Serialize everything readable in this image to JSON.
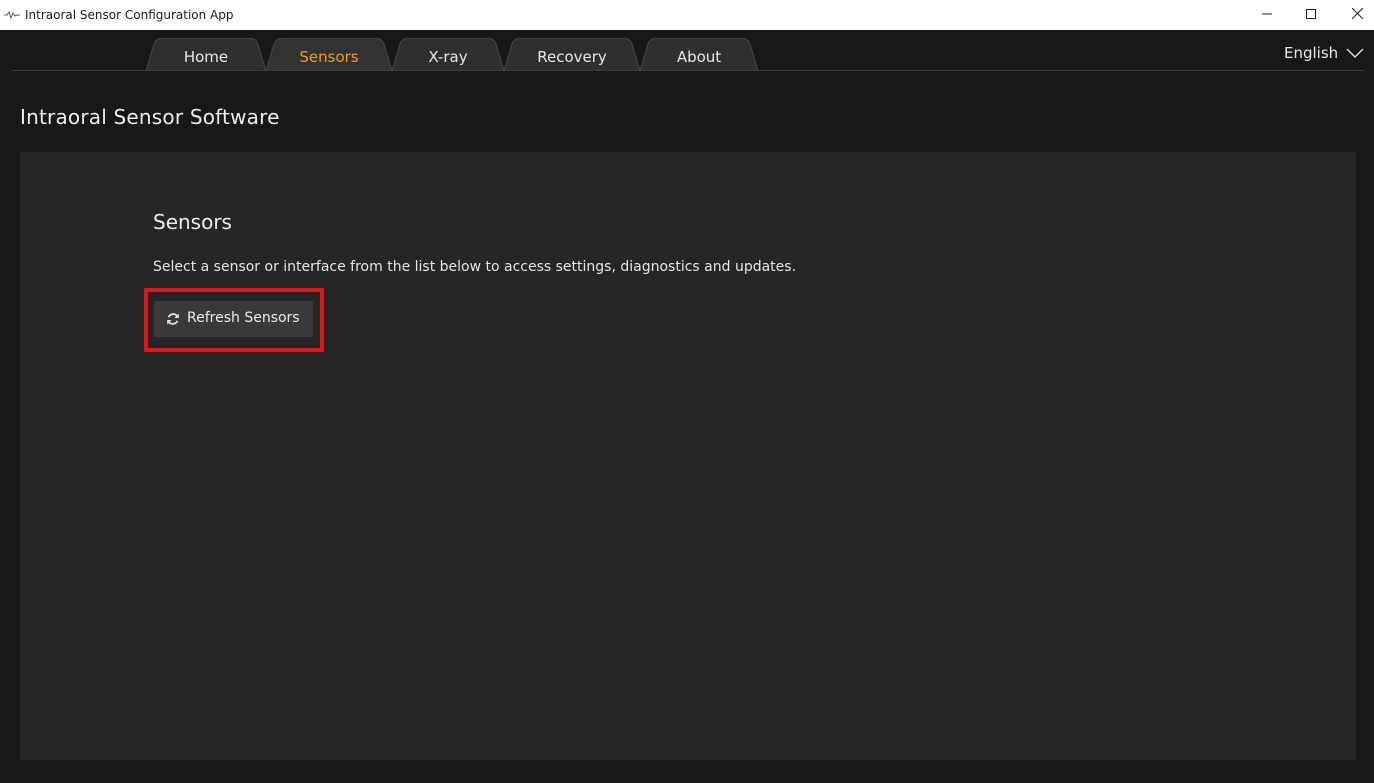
{
  "window": {
    "title": "Intraoral Sensor Configuration App",
    "icon": "app-signal-icon",
    "controls": [
      "minimize-icon",
      "maximize-icon",
      "close-icon"
    ]
  },
  "tabs": [
    {
      "label": "Home",
      "active": false
    },
    {
      "label": "Sensors",
      "active": true
    },
    {
      "label": "X-ray",
      "active": false
    },
    {
      "label": "Recovery",
      "active": false
    },
    {
      "label": "About",
      "active": false
    }
  ],
  "language": {
    "selected": "English",
    "icon": "chevron-down-icon"
  },
  "page": {
    "title": "Intraoral Sensor Software"
  },
  "section": {
    "title": "Sensors",
    "description": "Select a sensor or interface from the list below to access settings, diagnostics and updates."
  },
  "refresh_button": {
    "label": "Refresh Sensors",
    "icon": "refresh-icon"
  },
  "colors": {
    "active_tab": "#f39c1f",
    "highlight": "#e3151c",
    "background": "#181818",
    "panel": "#262626",
    "button": "#3a3a3a"
  }
}
